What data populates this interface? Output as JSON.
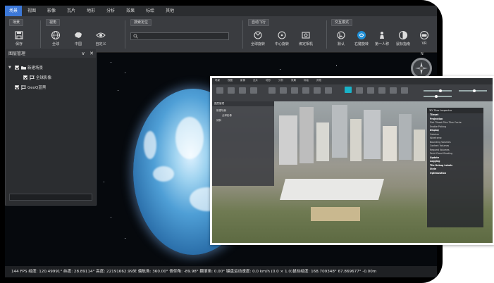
{
  "menu": {
    "items": [
      "场景",
      "视图",
      "影像",
      "瓦片",
      "地形",
      "分析",
      "效果",
      "标绘",
      "其他"
    ],
    "active_index": 0
  },
  "ribbon": {
    "groups": [
      {
        "title": "场景",
        "buttons": [
          {
            "label": "保存",
            "icon": "save-icon"
          }
        ]
      },
      {
        "title": "视角",
        "buttons": [
          {
            "label": "全球",
            "icon": "globe-icon"
          },
          {
            "label": "中国",
            "icon": "china-map-icon"
          },
          {
            "label": "自定义",
            "icon": "eye-icon"
          }
        ]
      },
      {
        "title": "搜索定位",
        "buttons": []
      },
      {
        "title": "自动飞行",
        "buttons": [
          {
            "label": "全球旋转",
            "icon": "rotate-globe-icon"
          },
          {
            "label": "中心旋转",
            "icon": "center-rotate-icon"
          },
          {
            "label": "绑定相机",
            "icon": "camera-bind-icon"
          }
        ]
      },
      {
        "title": "交互模式",
        "buttons": [
          {
            "label": "默认",
            "icon": "cursor-default-icon"
          },
          {
            "label": "右键旋转",
            "icon": "right-rotate-icon"
          },
          {
            "label": "第一人称",
            "icon": "first-person-icon"
          },
          {
            "label": "鼠标指南",
            "icon": "mouse-guide-icon"
          },
          {
            "label": "VR",
            "icon": "vr-icon"
          }
        ]
      }
    ],
    "search_placeholder": ""
  },
  "layer_panel": {
    "title": "图层管理",
    "minimize_glyph": "∨",
    "close_glyph": "✕",
    "tree": [
      {
        "label": "新建场景",
        "level": 0,
        "checked": true,
        "expanded": true
      },
      {
        "label": "全球影像",
        "level": 1,
        "checked": true
      },
      {
        "label": "GeoQ蓝黑",
        "level": 0,
        "checked": true
      }
    ]
  },
  "compass": {
    "north_label": "N"
  },
  "status_bar": {
    "text": "144 FPS 经度: 120.49991° 纬度: 28.89114° 高度: 22191662.99米 偏航角: 360.00° 俯仰角: -89.98° 翻滚角: 0.00° 键盘运动速度: 0.0 km/h (0.0 × 1.0)鼠标经度: 168.709348° 67.869677° -0.00m"
  },
  "inset": {
    "menu_items": [
      "场景",
      "视图",
      "影像",
      "瓦片",
      "地形",
      "分析",
      "效果",
      "标绘",
      "其他"
    ],
    "layer_panel_title": "图层管理",
    "layer_tree": [
      "新建场景",
      "全球影像",
      "倾斜"
    ],
    "tileset_inspector": {
      "title": "3D Tiles Inspector",
      "rows": [
        {
          "text": "Tileset",
          "header": true
        },
        {
          "text": "Projection",
          "header": true
        },
        {
          "text": "Pick Tileset    Trim Tiles Cache",
          "header": false
        },
        {
          "text": "Enable Picking",
          "header": false
        },
        {
          "text": "Display",
          "header": true
        },
        {
          "text": "Colorize",
          "header": false
        },
        {
          "text": "Wireframe",
          "header": false
        },
        {
          "text": "Bounding Volumes",
          "header": false
        },
        {
          "text": "Content Volumes",
          "header": false
        },
        {
          "text": "Request Volumes",
          "header": false
        },
        {
          "text": "Point Cloud Shading",
          "header": false
        },
        {
          "text": "Update",
          "header": true
        },
        {
          "text": "Logging",
          "header": true
        },
        {
          "text": "Tile Debug Labels",
          "header": true
        },
        {
          "text": "Style",
          "header": true
        },
        {
          "text": "Optimization",
          "header": true
        }
      ]
    }
  },
  "colors": {
    "accent": "#3c78d8",
    "panel_bg": "#2b2d30",
    "ribbon_bg": "#3a3c40",
    "inset_highlight": "#19b3c8"
  }
}
